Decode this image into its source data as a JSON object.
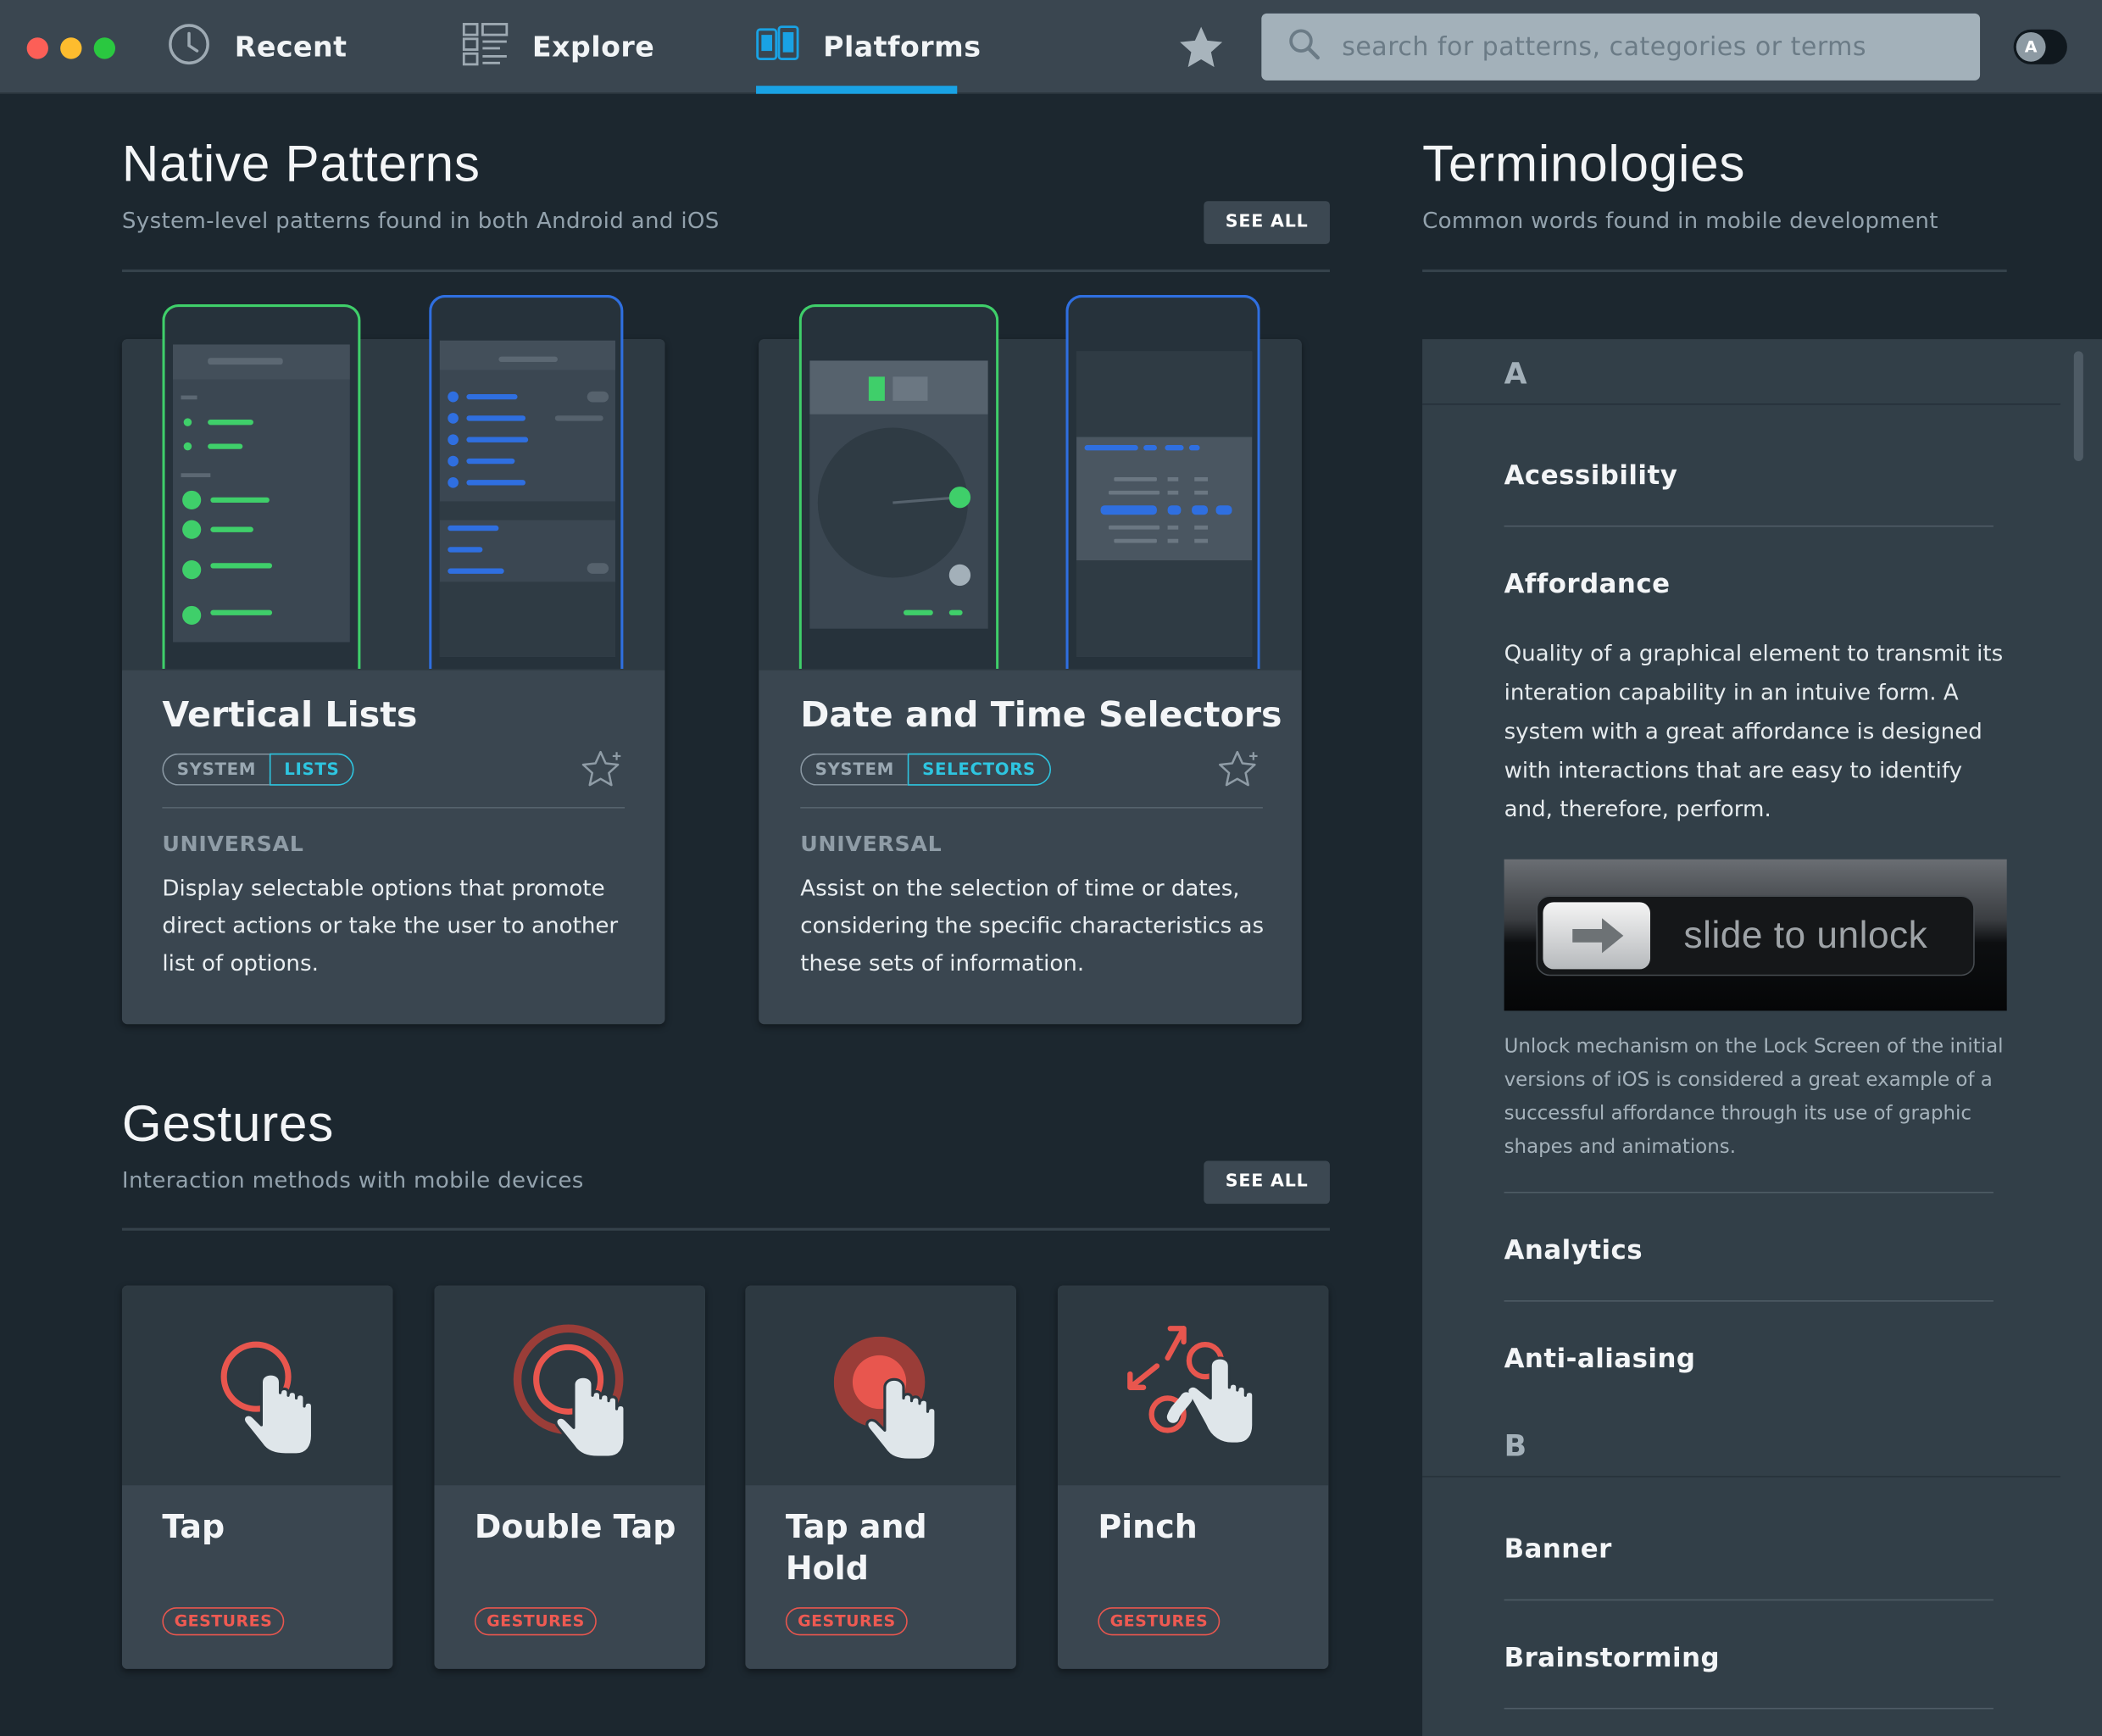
{
  "window": {
    "controls": {
      "close_color": "#fc5f57",
      "minimize_color": "#fdbc2e",
      "zoom_color": "#2ac840"
    }
  },
  "topbar": {
    "nav": [
      {
        "label": "Recent",
        "icon": "clock-icon"
      },
      {
        "label": "Explore",
        "icon": "grid-list-icon"
      },
      {
        "label": "Platforms",
        "icon": "devices-icon",
        "active": true
      }
    ],
    "favorites_icon": "star-icon",
    "search": {
      "placeholder": "search for patterns, categories or terms",
      "icon": "search-icon"
    },
    "account_toggle": {
      "label": "A"
    },
    "accent_color": "#19a2e4"
  },
  "native_patterns": {
    "title": "Native Patterns",
    "subtitle": "System-level patterns found in both Android and iOS",
    "see_all": "SEE ALL",
    "cards": [
      {
        "title": "Vertical Lists",
        "tag_primary": "SYSTEM",
        "tag_secondary": "LISTS",
        "kicker": "UNIVERSAL",
        "description": "Display selectable options that promote direct actions or take the user to another list of options."
      },
      {
        "title": "Date and Time Selectors",
        "tag_primary": "SYSTEM",
        "tag_secondary": "SELECTORS",
        "kicker": "UNIVERSAL",
        "description": "Assist on the selection of time or dates, considering the specific characteristics as these sets of information."
      }
    ]
  },
  "gestures": {
    "title": "Gestures",
    "subtitle": "Interaction methods with mobile devices",
    "see_all": "SEE ALL",
    "cards": [
      {
        "title": "Tap",
        "tag": "GESTURES",
        "icon": "tap-gesture-icon"
      },
      {
        "title": "Double Tap",
        "tag": "GESTURES",
        "icon": "double-tap-gesture-icon"
      },
      {
        "title": "Tap and Hold",
        "tag": "GESTURES",
        "icon": "tap-hold-gesture-icon"
      },
      {
        "title": "Pinch",
        "tag": "GESTURES",
        "icon": "pinch-gesture-icon"
      }
    ],
    "tag_color": "#ee5a52"
  },
  "terminologies": {
    "title": "Terminologies",
    "subtitle": "Common words found in mobile development",
    "groups": [
      {
        "letter": "A",
        "terms": [
          {
            "name": "Acessibility"
          },
          {
            "name": "Affordance",
            "description": "Quality of a graphical element to transmit its interation capability in an intuive form. A system with a great affordance is designed with interactions that are easy to identify and, therefore, perform.",
            "image_text": "slide to unlock",
            "caption": "Unlock mechanism on the Lock Screen of the initial versions of iOS is considered a great example of a successful affordance through its use of graphic shapes and animations."
          },
          {
            "name": "Analytics"
          },
          {
            "name": "Anti-aliasing"
          }
        ]
      },
      {
        "letter": "B",
        "terms": [
          {
            "name": "Banner"
          },
          {
            "name": "Brainstorming"
          }
        ]
      }
    ]
  }
}
